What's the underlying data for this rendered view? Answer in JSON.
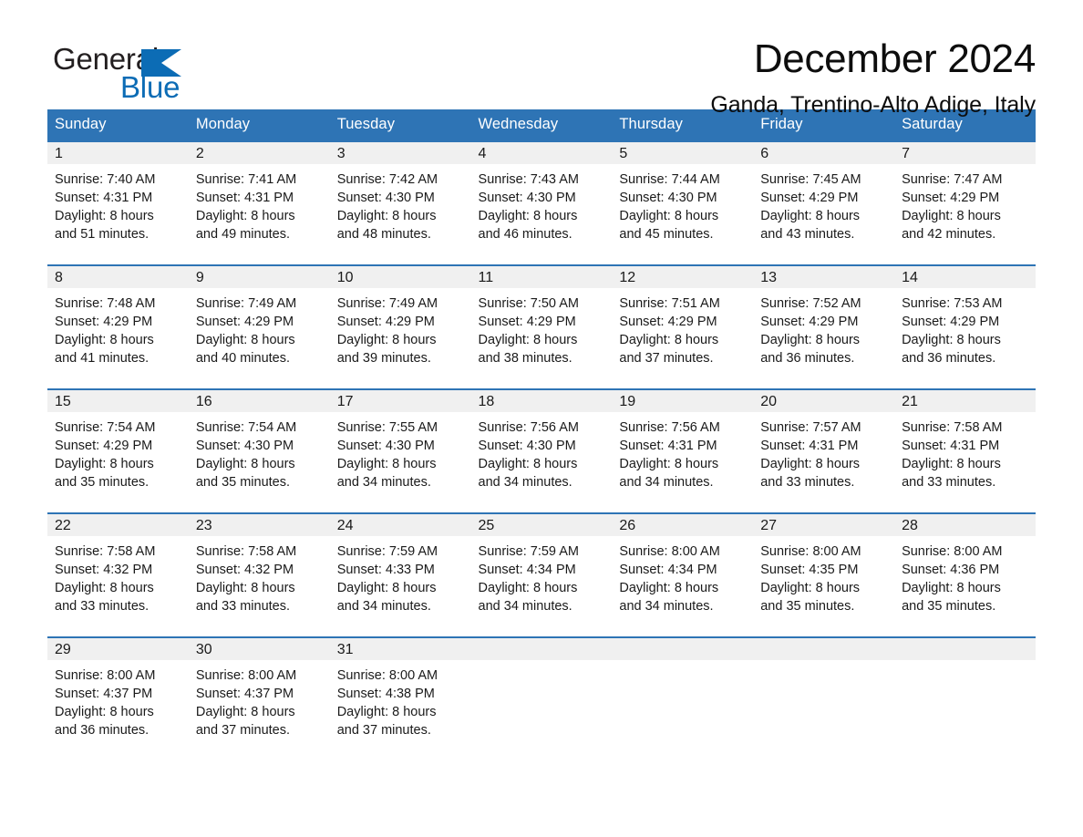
{
  "brand": {
    "name_part1": "General",
    "name_part2": "Blue",
    "logo_icon": "triangle-flag-icon",
    "accent_color": "#0c6cb5"
  },
  "header": {
    "month_title": "December 2024",
    "location": "Ganda, Trentino-Alto Adige, Italy"
  },
  "theme": {
    "header_blue": "#2e74b5",
    "row_border_blue": "#2e74b5",
    "daynum_band_gray": "#f0f0f0",
    "text_color": "#1a1a1a"
  },
  "calendar": {
    "weekday_headers": [
      "Sunday",
      "Monday",
      "Tuesday",
      "Wednesday",
      "Thursday",
      "Friday",
      "Saturday"
    ],
    "weeks": [
      [
        {
          "day": "1",
          "sunrise": "Sunrise: 7:40 AM",
          "sunset": "Sunset: 4:31 PM",
          "daylight_line1": "Daylight: 8 hours",
          "daylight_line2": "and 51 minutes."
        },
        {
          "day": "2",
          "sunrise": "Sunrise: 7:41 AM",
          "sunset": "Sunset: 4:31 PM",
          "daylight_line1": "Daylight: 8 hours",
          "daylight_line2": "and 49 minutes."
        },
        {
          "day": "3",
          "sunrise": "Sunrise: 7:42 AM",
          "sunset": "Sunset: 4:30 PM",
          "daylight_line1": "Daylight: 8 hours",
          "daylight_line2": "and 48 minutes."
        },
        {
          "day": "4",
          "sunrise": "Sunrise: 7:43 AM",
          "sunset": "Sunset: 4:30 PM",
          "daylight_line1": "Daylight: 8 hours",
          "daylight_line2": "and 46 minutes."
        },
        {
          "day": "5",
          "sunrise": "Sunrise: 7:44 AM",
          "sunset": "Sunset: 4:30 PM",
          "daylight_line1": "Daylight: 8 hours",
          "daylight_line2": "and 45 minutes."
        },
        {
          "day": "6",
          "sunrise": "Sunrise: 7:45 AM",
          "sunset": "Sunset: 4:29 PM",
          "daylight_line1": "Daylight: 8 hours",
          "daylight_line2": "and 43 minutes."
        },
        {
          "day": "7",
          "sunrise": "Sunrise: 7:47 AM",
          "sunset": "Sunset: 4:29 PM",
          "daylight_line1": "Daylight: 8 hours",
          "daylight_line2": "and 42 minutes."
        }
      ],
      [
        {
          "day": "8",
          "sunrise": "Sunrise: 7:48 AM",
          "sunset": "Sunset: 4:29 PM",
          "daylight_line1": "Daylight: 8 hours",
          "daylight_line2": "and 41 minutes."
        },
        {
          "day": "9",
          "sunrise": "Sunrise: 7:49 AM",
          "sunset": "Sunset: 4:29 PM",
          "daylight_line1": "Daylight: 8 hours",
          "daylight_line2": "and 40 minutes."
        },
        {
          "day": "10",
          "sunrise": "Sunrise: 7:49 AM",
          "sunset": "Sunset: 4:29 PM",
          "daylight_line1": "Daylight: 8 hours",
          "daylight_line2": "and 39 minutes."
        },
        {
          "day": "11",
          "sunrise": "Sunrise: 7:50 AM",
          "sunset": "Sunset: 4:29 PM",
          "daylight_line1": "Daylight: 8 hours",
          "daylight_line2": "and 38 minutes."
        },
        {
          "day": "12",
          "sunrise": "Sunrise: 7:51 AM",
          "sunset": "Sunset: 4:29 PM",
          "daylight_line1": "Daylight: 8 hours",
          "daylight_line2": "and 37 minutes."
        },
        {
          "day": "13",
          "sunrise": "Sunrise: 7:52 AM",
          "sunset": "Sunset: 4:29 PM",
          "daylight_line1": "Daylight: 8 hours",
          "daylight_line2": "and 36 minutes."
        },
        {
          "day": "14",
          "sunrise": "Sunrise: 7:53 AM",
          "sunset": "Sunset: 4:29 PM",
          "daylight_line1": "Daylight: 8 hours",
          "daylight_line2": "and 36 minutes."
        }
      ],
      [
        {
          "day": "15",
          "sunrise": "Sunrise: 7:54 AM",
          "sunset": "Sunset: 4:29 PM",
          "daylight_line1": "Daylight: 8 hours",
          "daylight_line2": "and 35 minutes."
        },
        {
          "day": "16",
          "sunrise": "Sunrise: 7:54 AM",
          "sunset": "Sunset: 4:30 PM",
          "daylight_line1": "Daylight: 8 hours",
          "daylight_line2": "and 35 minutes."
        },
        {
          "day": "17",
          "sunrise": "Sunrise: 7:55 AM",
          "sunset": "Sunset: 4:30 PM",
          "daylight_line1": "Daylight: 8 hours",
          "daylight_line2": "and 34 minutes."
        },
        {
          "day": "18",
          "sunrise": "Sunrise: 7:56 AM",
          "sunset": "Sunset: 4:30 PM",
          "daylight_line1": "Daylight: 8 hours",
          "daylight_line2": "and 34 minutes."
        },
        {
          "day": "19",
          "sunrise": "Sunrise: 7:56 AM",
          "sunset": "Sunset: 4:31 PM",
          "daylight_line1": "Daylight: 8 hours",
          "daylight_line2": "and 34 minutes."
        },
        {
          "day": "20",
          "sunrise": "Sunrise: 7:57 AM",
          "sunset": "Sunset: 4:31 PM",
          "daylight_line1": "Daylight: 8 hours",
          "daylight_line2": "and 33 minutes."
        },
        {
          "day": "21",
          "sunrise": "Sunrise: 7:58 AM",
          "sunset": "Sunset: 4:31 PM",
          "daylight_line1": "Daylight: 8 hours",
          "daylight_line2": "and 33 minutes."
        }
      ],
      [
        {
          "day": "22",
          "sunrise": "Sunrise: 7:58 AM",
          "sunset": "Sunset: 4:32 PM",
          "daylight_line1": "Daylight: 8 hours",
          "daylight_line2": "and 33 minutes."
        },
        {
          "day": "23",
          "sunrise": "Sunrise: 7:58 AM",
          "sunset": "Sunset: 4:32 PM",
          "daylight_line1": "Daylight: 8 hours",
          "daylight_line2": "and 33 minutes."
        },
        {
          "day": "24",
          "sunrise": "Sunrise: 7:59 AM",
          "sunset": "Sunset: 4:33 PM",
          "daylight_line1": "Daylight: 8 hours",
          "daylight_line2": "and 34 minutes."
        },
        {
          "day": "25",
          "sunrise": "Sunrise: 7:59 AM",
          "sunset": "Sunset: 4:34 PM",
          "daylight_line1": "Daylight: 8 hours",
          "daylight_line2": "and 34 minutes."
        },
        {
          "day": "26",
          "sunrise": "Sunrise: 8:00 AM",
          "sunset": "Sunset: 4:34 PM",
          "daylight_line1": "Daylight: 8 hours",
          "daylight_line2": "and 34 minutes."
        },
        {
          "day": "27",
          "sunrise": "Sunrise: 8:00 AM",
          "sunset": "Sunset: 4:35 PM",
          "daylight_line1": "Daylight: 8 hours",
          "daylight_line2": "and 35 minutes."
        },
        {
          "day": "28",
          "sunrise": "Sunrise: 8:00 AM",
          "sunset": "Sunset: 4:36 PM",
          "daylight_line1": "Daylight: 8 hours",
          "daylight_line2": "and 35 minutes."
        }
      ],
      [
        {
          "day": "29",
          "sunrise": "Sunrise: 8:00 AM",
          "sunset": "Sunset: 4:37 PM",
          "daylight_line1": "Daylight: 8 hours",
          "daylight_line2": "and 36 minutes."
        },
        {
          "day": "30",
          "sunrise": "Sunrise: 8:00 AM",
          "sunset": "Sunset: 4:37 PM",
          "daylight_line1": "Daylight: 8 hours",
          "daylight_line2": "and 37 minutes."
        },
        {
          "day": "31",
          "sunrise": "Sunrise: 8:00 AM",
          "sunset": "Sunset: 4:38 PM",
          "daylight_line1": "Daylight: 8 hours",
          "daylight_line2": "and 37 minutes."
        },
        {
          "day": "",
          "sunrise": "",
          "sunset": "",
          "daylight_line1": "",
          "daylight_line2": ""
        },
        {
          "day": "",
          "sunrise": "",
          "sunset": "",
          "daylight_line1": "",
          "daylight_line2": ""
        },
        {
          "day": "",
          "sunrise": "",
          "sunset": "",
          "daylight_line1": "",
          "daylight_line2": ""
        },
        {
          "day": "",
          "sunrise": "",
          "sunset": "",
          "daylight_line1": "",
          "daylight_line2": ""
        }
      ]
    ]
  }
}
